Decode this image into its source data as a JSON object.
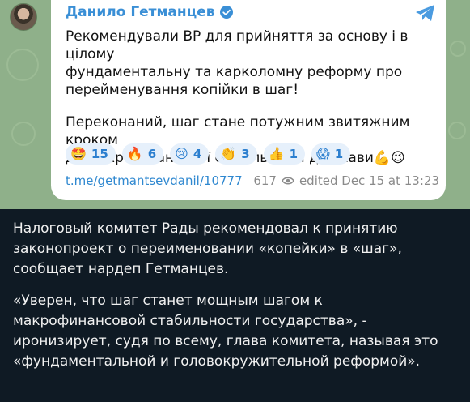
{
  "post": {
    "author": "Данило Гетманцев",
    "verified_icon": "verified-badge-icon",
    "platform_icon": "telegram-icon",
    "message": [
      "Рекомендували ВР для прийняття за основу і в цілому\nфундаментальну та карколомну реформу про\nперейменування копійки в шаг!",
      "Переконаний, шаг стане потужним звитяжним кроком\nдо макрофінансової стабільності держави💪😉"
    ],
    "reactions": [
      {
        "emoji": "🤩",
        "count": "15"
      },
      {
        "emoji": "🔥",
        "count": "6"
      },
      {
        "emoji": "😢",
        "count": "4"
      },
      {
        "emoji": "👏",
        "count": "3"
      },
      {
        "emoji": "👍",
        "count": "1"
      },
      {
        "emoji": "😱",
        "count": "1"
      }
    ],
    "link": "t.me/getmantsevdanil/10777",
    "views": "617",
    "edited": "edited  Dec 15 at 13:23"
  },
  "caption": [
    "Налоговый комитет Рады рекомендовал к принятию\nзаконопроект о переименовании «копейки» в «шаг»,\nсообщает нардеп Гетманцев.",
    "«Уверен, что шаг станет мощным шагом к\nмакрофинансовой стабильности государства», -\nиронизирует, судя по всему, глава комитета, называя это\n«фундаментальной и головокружительной реформой»."
  ],
  "colors": {
    "chat_background": "#8fb08a",
    "author": "#3a8fd6",
    "reaction_bg": "#e6f0fb",
    "link": "#2f88d0",
    "caption_bg": "#0f1a24"
  }
}
